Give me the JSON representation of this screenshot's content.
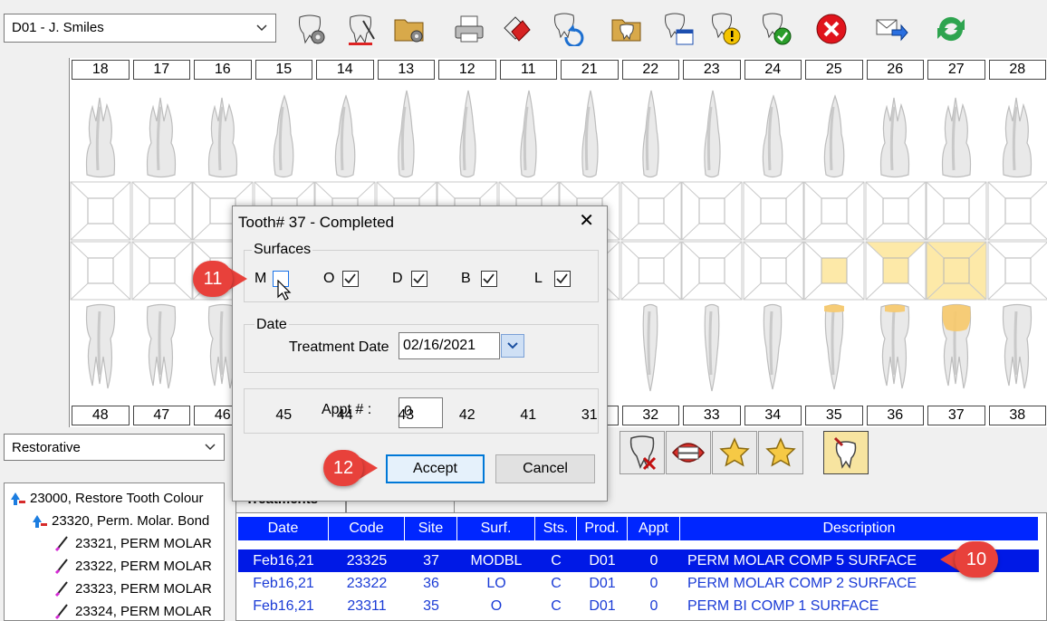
{
  "toolbar": {
    "provider": "D01 - J. Smiles",
    "icons": [
      "tooth-settings-icon",
      "tooth-draw-icon",
      "folder-settings-icon",
      "printer-icon",
      "paint-fill-icon",
      "tooth-refresh-icon",
      "tooth-folder-icon",
      "tooth-calendar-icon",
      "tooth-warning-icon",
      "tooth-check-icon",
      "close-circle-icon",
      "send-mail-icon",
      "sync-arrows-icon"
    ]
  },
  "chart": {
    "upper_numbers": [
      "18",
      "17",
      "16",
      "15",
      "14",
      "13",
      "12",
      "11",
      "21",
      "22",
      "23",
      "24",
      "25",
      "26",
      "27",
      "28"
    ],
    "lower_numbers": [
      "48",
      "47",
      "46",
      "45",
      "44",
      "43",
      "42",
      "41",
      "31",
      "32",
      "33",
      "34",
      "35",
      "36",
      "37",
      "38"
    ],
    "highlight_color": "#fde9a8",
    "crown_color": "#f7c96a"
  },
  "category": {
    "selected": "Restorative"
  },
  "tree": {
    "items": [
      {
        "label": "23000, Restore Tooth Colour"
      },
      {
        "label": "23320, Perm. Molar. Bond"
      },
      {
        "label": "23321, PERM MOLAR"
      },
      {
        "label": "23322, PERM MOLAR"
      },
      {
        "label": "23323, PERM MOLAR"
      },
      {
        "label": "23324, PERM MOLAR"
      }
    ]
  },
  "tools": [
    "tooth-remove-icon",
    "denture-icon",
    "star-icon",
    "star-icon",
    "tooth-pen-icon"
  ],
  "tabs": {
    "treatments": "Treatments"
  },
  "grid": {
    "headers": [
      "Date",
      "Code",
      "Site",
      "Surf.",
      "Sts.",
      "Prod.",
      "Appt",
      "Description"
    ],
    "rows": [
      {
        "date": "Feb16,21",
        "code": "23325",
        "site": "37",
        "surf": "MODBL",
        "sts": "C",
        "prod": "D01",
        "appt": "0",
        "desc": "PERM MOLAR COMP 5 SURFACE"
      },
      {
        "date": "Feb16,21",
        "code": "23322",
        "site": "36",
        "surf": "LO",
        "sts": "C",
        "prod": "D01",
        "appt": "0",
        "desc": "PERM MOLAR COMP 2 SURFACE"
      },
      {
        "date": "Feb16,21",
        "code": "23311",
        "site": "35",
        "surf": "O",
        "sts": "C",
        "prod": "D01",
        "appt": "0",
        "desc": "PERM BI COMP 1 SURFACE"
      }
    ]
  },
  "dialog": {
    "title": "Tooth# 37 - Completed",
    "surfaces_label": "Surfaces",
    "surfaces": [
      {
        "label": "M",
        "checked": false
      },
      {
        "label": "O",
        "checked": true
      },
      {
        "label": "D",
        "checked": true
      },
      {
        "label": "B",
        "checked": true
      },
      {
        "label": "L",
        "checked": true
      }
    ],
    "date_label": "Date",
    "treatment_date_label": "Treatment Date",
    "treatment_date": "02/16/2021",
    "appt_label": "Appt # :",
    "appt_value": "0",
    "accept": "Accept",
    "cancel": "Cancel"
  },
  "callouts": {
    "c10": "10",
    "c11": "11",
    "c12": "12",
    "color": "#e8413b"
  }
}
